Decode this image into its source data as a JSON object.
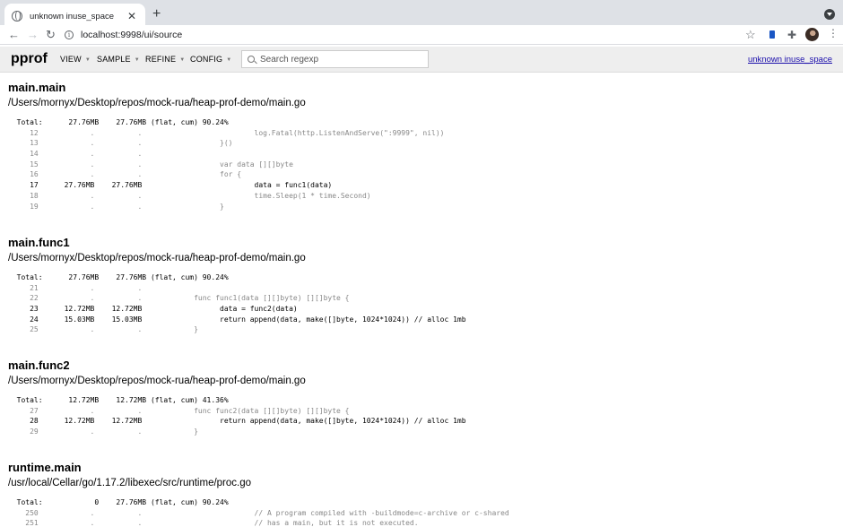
{
  "browser": {
    "tab_title": "unknown inuse_space",
    "url": "localhost:9998/ui/source"
  },
  "header": {
    "logo": "pprof",
    "menus": [
      "VIEW",
      "SAMPLE",
      "REFINE",
      "CONFIG"
    ],
    "search_placeholder": "Search regexp",
    "profile_link": "unknown inuse_space"
  },
  "sections": [
    {
      "name": "main.main",
      "file": "/Users/mornyx/Desktop/repos/mock-rua/heap-prof-demo/main.go",
      "lines": [
        {
          "text": "  Total:      27.76MB    27.76MB (flat, cum) 90.24%",
          "dim": false
        },
        {
          "text": "     12            .          .                          log.Fatal(http.ListenAndServe(\":9999\", nil))",
          "dim": true
        },
        {
          "text": "     13            .          .                  }()",
          "dim": true
        },
        {
          "text": "     14            .          .",
          "dim": true
        },
        {
          "text": "     15            .          .                  var data [][]byte",
          "dim": true
        },
        {
          "text": "     16            .          .                  for {",
          "dim": true
        },
        {
          "text": "     17      27.76MB    27.76MB                          data = func1(data)",
          "dim": false
        },
        {
          "text": "     18            .          .                          time.Sleep(1 * time.Second)",
          "dim": true
        },
        {
          "text": "     19            .          .                  }",
          "dim": true
        }
      ]
    },
    {
      "name": "main.func1",
      "file": "/Users/mornyx/Desktop/repos/mock-rua/heap-prof-demo/main.go",
      "lines": [
        {
          "text": "  Total:      27.76MB    27.76MB (flat, cum) 90.24%",
          "dim": false
        },
        {
          "text": "     21            .          .",
          "dim": true
        },
        {
          "text": "     22            .          .            func func1(data [][]byte) [][]byte {",
          "dim": true
        },
        {
          "text": "     23      12.72MB    12.72MB                  data = func2(data)",
          "dim": false
        },
        {
          "text": "     24      15.03MB    15.03MB                  return append(data, make([]byte, 1024*1024)) // alloc 1mb",
          "dim": false
        },
        {
          "text": "     25            .          .            }",
          "dim": true
        }
      ]
    },
    {
      "name": "main.func2",
      "file": "/Users/mornyx/Desktop/repos/mock-rua/heap-prof-demo/main.go",
      "lines": [
        {
          "text": "  Total:      12.72MB    12.72MB (flat, cum) 41.36%",
          "dim": false
        },
        {
          "text": "     27            .          .            func func2(data [][]byte) [][]byte {",
          "dim": true
        },
        {
          "text": "     28      12.72MB    12.72MB                  return append(data, make([]byte, 1024*1024)) // alloc 1mb",
          "dim": false
        },
        {
          "text": "     29            .          .            }",
          "dim": true
        }
      ]
    },
    {
      "name": "runtime.main",
      "file": "/usr/local/Cellar/go/1.17.2/libexec/src/runtime/proc.go",
      "lines": [
        {
          "text": "  Total:            0    27.76MB (flat, cum) 90.24%",
          "dim": false
        },
        {
          "text": "    250            .          .                          // A program compiled with -buildmode=c-archive or c-shared",
          "dim": true
        },
        {
          "text": "    251            .          .                          // has a main, but it is not executed.",
          "dim": true
        }
      ]
    }
  ]
}
